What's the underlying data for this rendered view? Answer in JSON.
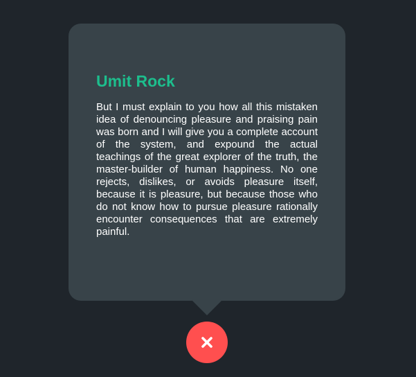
{
  "popup": {
    "title": "Umit Rock",
    "body": "But I must explain to you how all this mistaken idea of denouncing pleasure and praising pain was born and I will give you a complete account of the system, and expound the actual teachings of the great explorer of the truth, the master-builder of human happiness. No one rejects, dislikes, or avoids pleasure itself, because it is pleasure, but because those who do not know how to pursue pleasure rationally encounter consequences that are extremely painful."
  },
  "close_button": {
    "icon": "close-icon",
    "color": "#ff4f4f"
  },
  "colors": {
    "background": "#1f252b",
    "panel": "#384349",
    "accent": "#1dbe8d",
    "text": "#ffffff"
  }
}
